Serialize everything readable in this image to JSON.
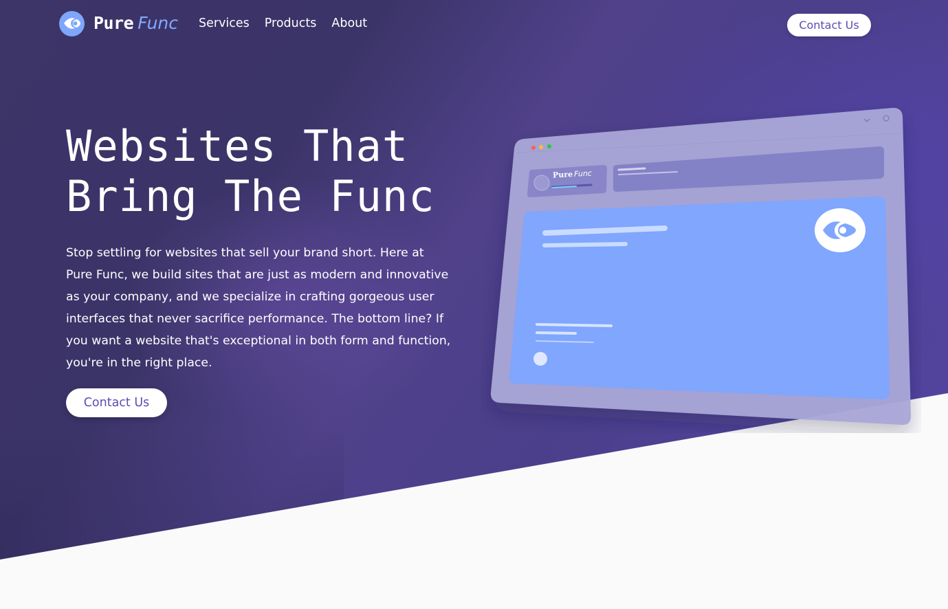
{
  "brand": {
    "name_part1": "Pure",
    "name_part2": "Func",
    "accent_color": "#7ea6fb",
    "logo_icon": "eye-icon"
  },
  "nav": {
    "links": [
      {
        "label": "Services"
      },
      {
        "label": "Products"
      },
      {
        "label": "About"
      }
    ],
    "cta_label": "Contact Us"
  },
  "hero": {
    "headline_line1": "Websites That",
    "headline_line2": "Bring The Func",
    "intro": "Stop settling for websites that sell your brand short. Here at Pure Func, we build sites that are just as modern and innovative as your company, and we specialize in crafting gorgeous user interfaces that never sacrifice performance. The bottom line? If you want a website that's exceptional in both form and function, you're in the right place.",
    "cta_label": "Contact Us"
  },
  "illustration": {
    "mini_brand_part1": "Pure",
    "mini_brand_part2": "Func",
    "window_dots": [
      "#ff5f56",
      "#ffbd2e",
      "#27c93f"
    ],
    "panel_color": "#80a6fd",
    "frame_color": "#aba7d8"
  },
  "colors": {
    "hero_gradient_start": "#3d3467",
    "hero_gradient_end": "#5546a6",
    "button_text": "#5a4db3",
    "page_background": "#fafafa"
  }
}
